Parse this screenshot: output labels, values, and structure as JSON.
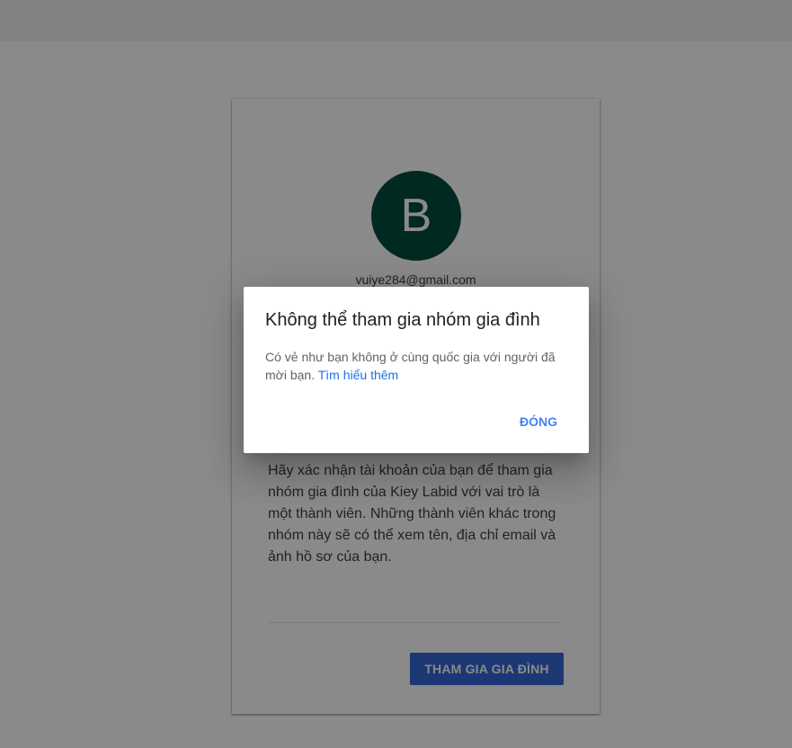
{
  "account": {
    "avatar_letter": "B",
    "email": "vuiye284@gmail.com"
  },
  "card": {
    "description": "Hãy xác nhận tài khoản của bạn để tham gia nhóm gia đình của Kiey Labid với vai trò là một thành viên. Những thành viên khác trong nhóm này sẽ có thể xem tên, địa chỉ email và ảnh hồ sơ của bạn.",
    "join_button_label": "THAM GIA GIA ĐÌNH"
  },
  "dialog": {
    "title": "Không thể tham gia nhóm gia đình",
    "body": "Có vẻ như bạn không ở cùng quốc gia với người đã mời bạn.",
    "learn_more_link": "Tìm hiểu thêm",
    "close_button_label": "ĐÓNG"
  },
  "colors": {
    "avatar_bg": "#004d40",
    "primary_button": "#3367d6",
    "link": "#1a73e8",
    "dialog_action": "#4285f4"
  }
}
